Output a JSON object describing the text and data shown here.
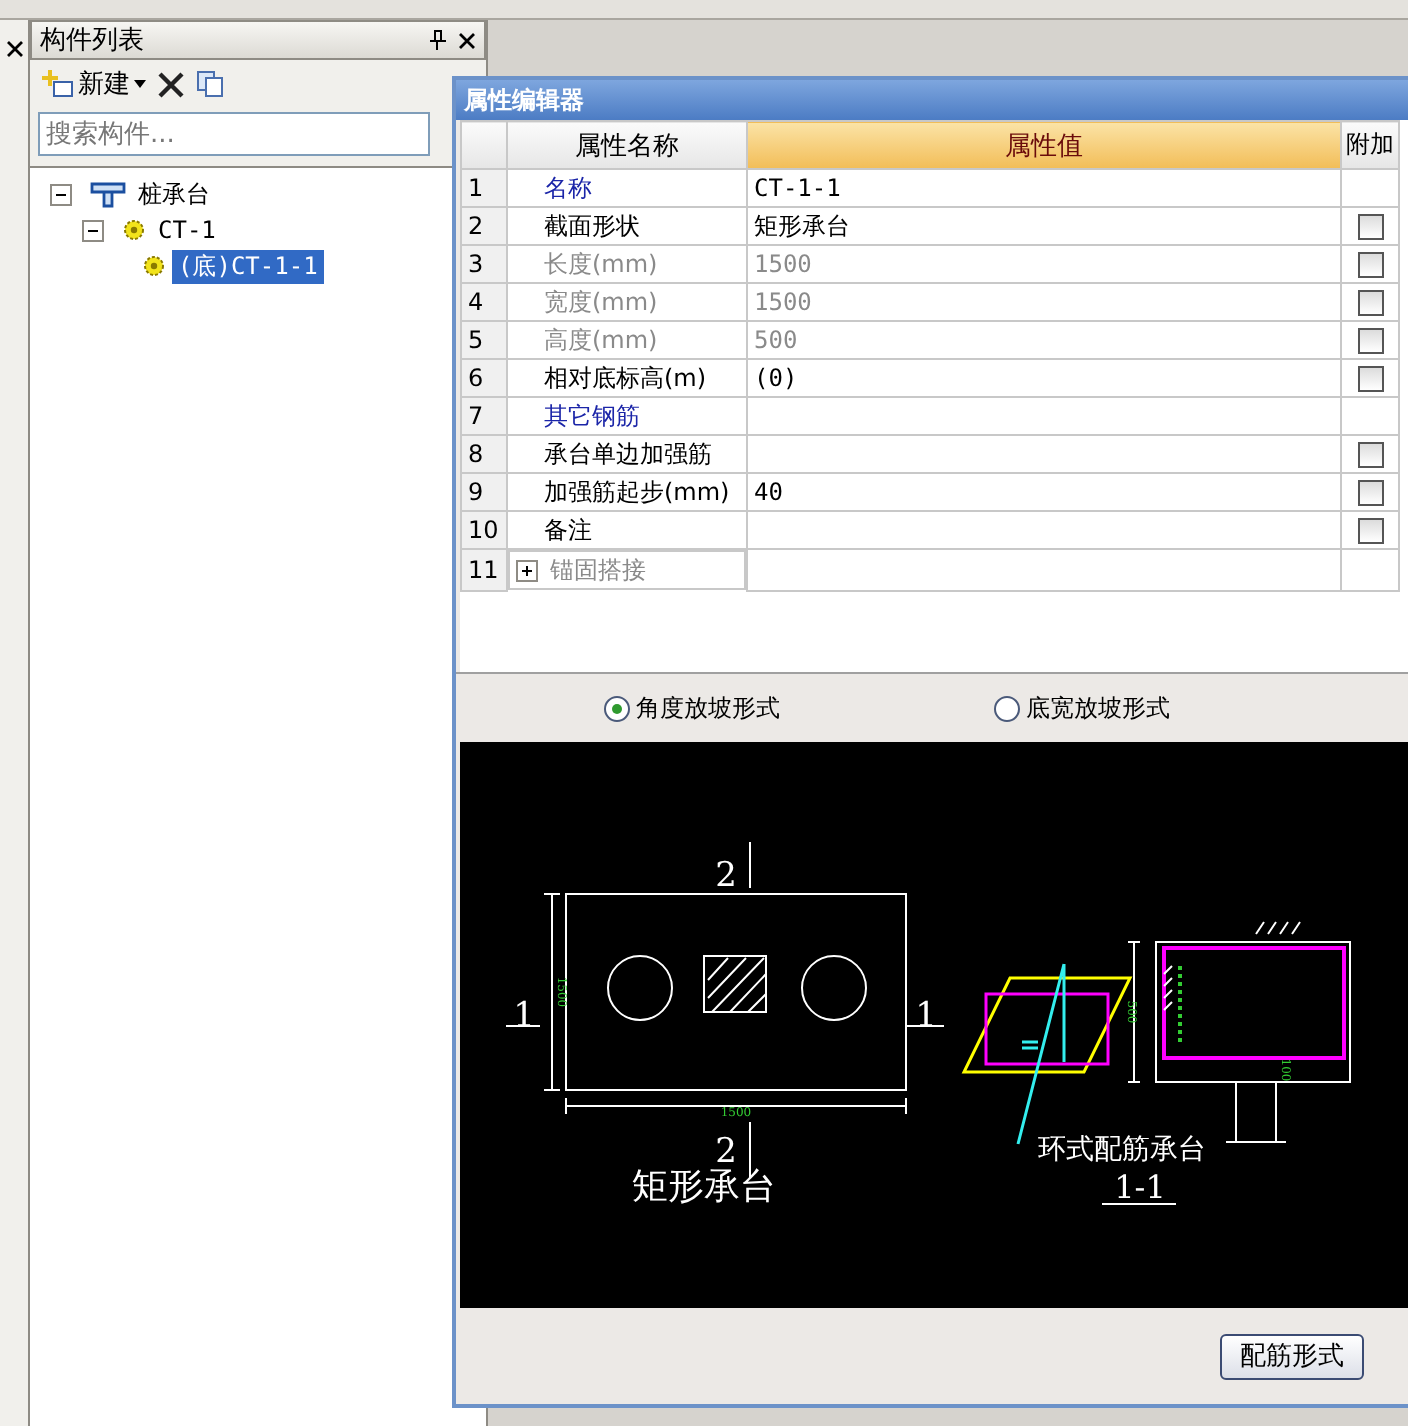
{
  "side_panel": {
    "title": "构件列表",
    "toolbar": {
      "new_label": "新建"
    },
    "search": {
      "placeholder": "搜索构件..."
    },
    "tree": [
      {
        "label": "桩承台",
        "kind": "category",
        "expanded": true,
        "selected": false,
        "children": [
          {
            "label": "CT-1",
            "kind": "type",
            "expanded": true,
            "selected": false,
            "children": [
              {
                "label": "(底)CT-1-1",
                "kind": "type",
                "selected": true
              }
            ]
          }
        ]
      }
    ]
  },
  "property_editor": {
    "title": "属性编辑器",
    "columns": [
      "属性名称",
      "属性值",
      "附加"
    ],
    "rows": [
      {
        "num": "1",
        "name": "名称",
        "value": "CT-1-1",
        "kind": "heading"
      },
      {
        "num": "2",
        "name": "截面形状",
        "value": "矩形承台",
        "kind": "normal",
        "checked": false
      },
      {
        "num": "3",
        "name": "长度(mm)",
        "value": "1500",
        "kind": "disabled",
        "checked": false
      },
      {
        "num": "4",
        "name": "宽度(mm)",
        "value": "1500",
        "kind": "disabled",
        "checked": false
      },
      {
        "num": "5",
        "name": "高度(mm)",
        "value": "500",
        "kind": "disabled",
        "checked": false
      },
      {
        "num": "6",
        "name": "相对底标高(m)",
        "value": "(0)",
        "kind": "normal",
        "checked": false
      },
      {
        "num": "7",
        "name": "其它钢筋",
        "kind": "heading"
      },
      {
        "num": "8",
        "name": "承台单边加强筋",
        "kind": "normal",
        "checked": false
      },
      {
        "num": "9",
        "name": "加强筋起步(mm)",
        "value": "40",
        "kind": "normal",
        "checked": false
      },
      {
        "num": "10",
        "name": "备注",
        "kind": "normal",
        "checked": false
      },
      {
        "num": "11",
        "name": "锚固搭接",
        "kind": "group",
        "expanded": false
      }
    ],
    "radios": [
      {
        "label": "角度放坡形式",
        "selected": true
      },
      {
        "label": "底宽放坡形式",
        "selected": false
      }
    ],
    "drawing": {
      "plan": {
        "section_marks": [
          "2",
          "1",
          "1",
          "2"
        ],
        "length_dim": "1500",
        "width_dim": "1500",
        "caption": "矩形承台"
      },
      "section": {
        "height_dim": "500",
        "cover_dim": "100",
        "caption": "环式配筋承台",
        "section_label": "1-1"
      }
    },
    "button": "配筋形式"
  }
}
